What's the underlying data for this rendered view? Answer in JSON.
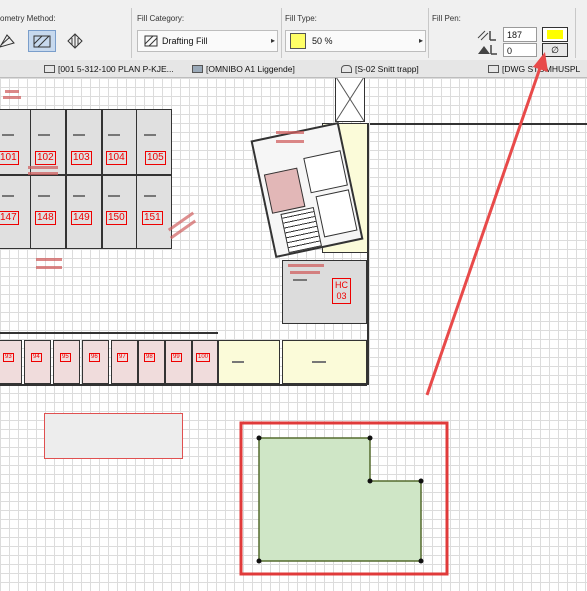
{
  "toolbar": {
    "geometry_label": "ometry Method:",
    "fill_category_label": "Fill Category:",
    "fill_category_value": "Drafting Fill",
    "fill_type_label": "Fill Type:",
    "fill_type_value": "50 %",
    "fill_pen_label": "Fill Pen:",
    "fill_pen_value": "187",
    "bg_pen_value": "0",
    "fill_pen_color": "#ffff00",
    "fill_type_swatch_color": "#ffff66"
  },
  "tabs": [
    {
      "label": "[001 5-312-100 PLAN P-KJE...",
      "icon": "plan-view-icon"
    },
    {
      "label": "[OMNIBO A1 Liggende]",
      "icon": "layout-icon"
    },
    {
      "label": "[S-02 Snitt trapp]",
      "icon": "section-icon"
    },
    {
      "label": "[DWG  STOMHUSPL",
      "icon": "dwg-icon"
    }
  ],
  "rooms_upper": [
    "101",
    "102",
    "103",
    "104",
    "105"
  ],
  "rooms_lower": [
    "147",
    "148",
    "149",
    "150",
    "151"
  ],
  "storage_rooms": [
    "93",
    "94",
    "95",
    "96",
    "97",
    "98",
    "99",
    "100"
  ],
  "hc_label": "HC",
  "hc_number": "03",
  "colors": {
    "highlight": "#e03a3a",
    "arrow": "#e84a4a",
    "polygon_fill": "#cfe6c6",
    "polygon_stroke": "#556b2f",
    "selection_rect": "#e05050"
  }
}
